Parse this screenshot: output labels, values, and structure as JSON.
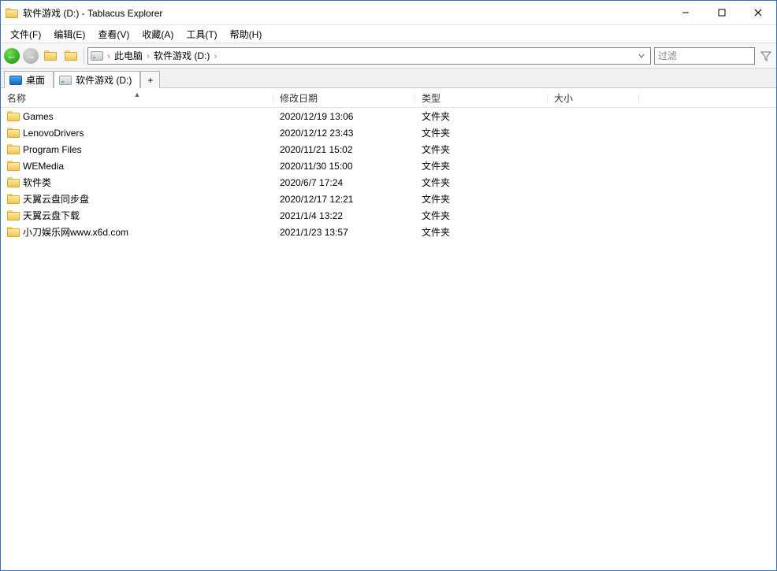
{
  "window_title": "软件游戏 (D:) - Tablacus Explorer",
  "menus": {
    "file": "文件(F)",
    "edit": "编辑(E)",
    "view": "查看(V)",
    "fav": "收藏(A)",
    "tools": "工具(T)",
    "help": "帮助(H)"
  },
  "toolbar": {
    "back_tip": "back",
    "forward_tip": "forward",
    "up_tip": "up",
    "folders_tip": "folders"
  },
  "address": {
    "crumbs": [
      "此电脑",
      "软件游戏 (D:)"
    ],
    "sep": "›"
  },
  "search": {
    "placeholder": "过滤"
  },
  "tabs": [
    {
      "icon": "desktop",
      "label": "桌面",
      "active": false
    },
    {
      "icon": "drive",
      "label": "软件游戏 (D:)",
      "active": true
    }
  ],
  "new_tab_label": "+",
  "columns": {
    "name": "名称",
    "modified": "修改日期",
    "type": "类型",
    "size": "大小"
  },
  "sort_indicator": "▲",
  "rows": [
    {
      "name": "Games",
      "modified": "2020/12/19 13:06",
      "type": "文件夹",
      "size": ""
    },
    {
      "name": "LenovoDrivers",
      "modified": "2020/12/12 23:43",
      "type": "文件夹",
      "size": ""
    },
    {
      "name": "Program Files",
      "modified": "2020/11/21 15:02",
      "type": "文件夹",
      "size": ""
    },
    {
      "name": "WEMedia",
      "modified": "2020/11/30 15:00",
      "type": "文件夹",
      "size": ""
    },
    {
      "name": "软件类",
      "modified": "2020/6/7 17:24",
      "type": "文件夹",
      "size": ""
    },
    {
      "name": "天翼云盘同步盘",
      "modified": "2020/12/17 12:21",
      "type": "文件夹",
      "size": ""
    },
    {
      "name": "天翼云盘下载",
      "modified": "2021/1/4 13:22",
      "type": "文件夹",
      "size": ""
    },
    {
      "name": "小刀娱乐网www.x6d.com",
      "modified": "2021/1/23 13:57",
      "type": "文件夹",
      "size": ""
    }
  ]
}
